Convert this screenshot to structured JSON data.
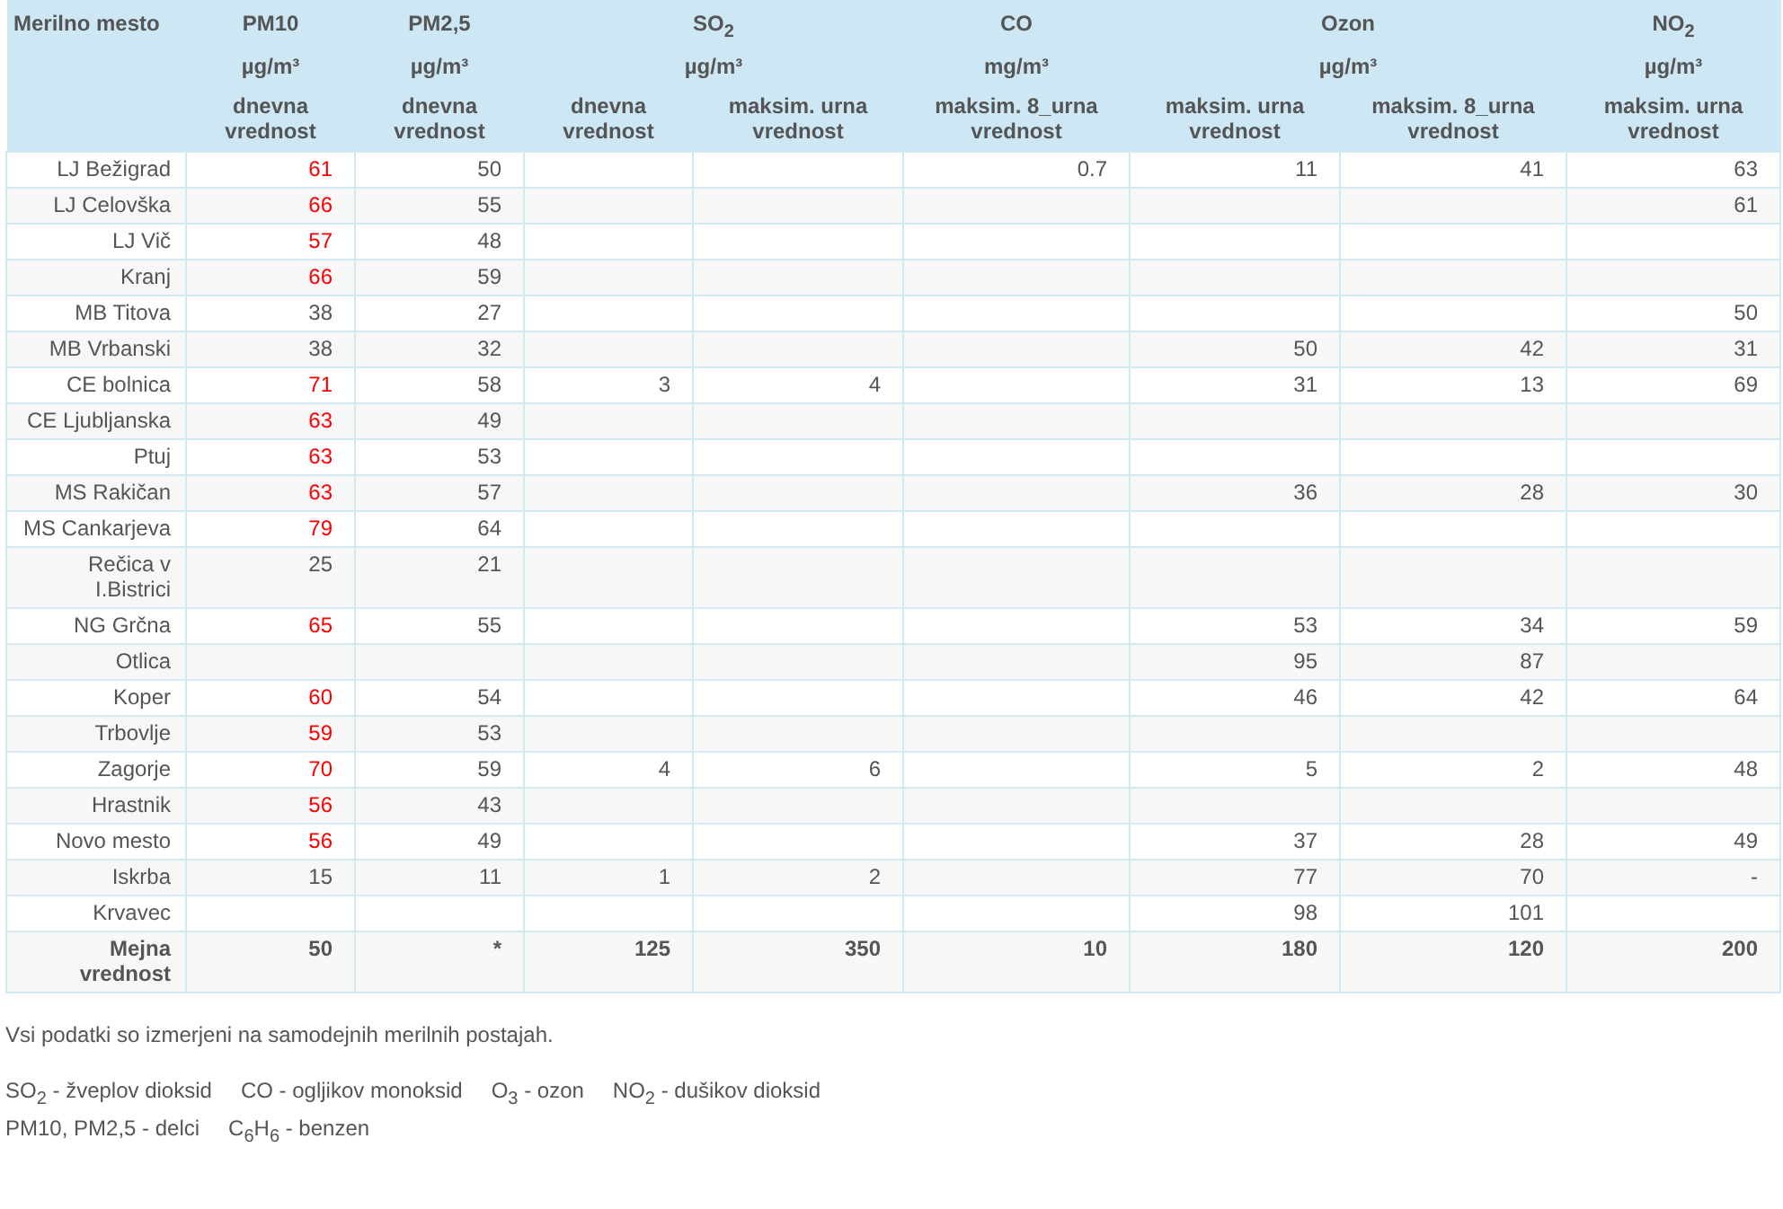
{
  "table": {
    "station_header": "Merilno mesto",
    "groups": [
      {
        "title": "PM10",
        "unit": "µg/m³",
        "columns": [
          "dnevna vrednost"
        ]
      },
      {
        "title": "PM2,5",
        "unit": "µg/m³",
        "columns": [
          "dnevna vrednost"
        ]
      },
      {
        "title": "SO$_{2}$",
        "unit": "µg/m³",
        "columns": [
          "dnevna vrednost",
          "maksim. urna vrednost"
        ]
      },
      {
        "title": "CO",
        "unit": "mg/m³",
        "columns": [
          "maksim. 8_urna vrednost"
        ]
      },
      {
        "title": "Ozon",
        "unit": "µg/m³",
        "columns": [
          "maksim. urna vrednost",
          "maksim. 8_urna vrednost"
        ]
      },
      {
        "title": "NO$_{2}$",
        "unit": "µg/m³",
        "columns": [
          "maksim. urna vrednost"
        ]
      }
    ],
    "rows": [
      {
        "kind": "station",
        "station": "LJ Bežigrad",
        "cells": [
          {
            "value": "61",
            "exceeded": true
          },
          {
            "value": "50"
          },
          null,
          null,
          {
            "value": "0.7"
          },
          {
            "value": "11"
          },
          {
            "value": "41"
          },
          {
            "value": "63"
          }
        ]
      },
      {
        "kind": "station",
        "station": "LJ Celovška",
        "cells": [
          {
            "value": "66",
            "exceeded": true
          },
          {
            "value": "55"
          },
          null,
          null,
          null,
          null,
          null,
          {
            "value": "61"
          }
        ]
      },
      {
        "kind": "station",
        "station": "LJ Vič",
        "cells": [
          {
            "value": "57",
            "exceeded": true
          },
          {
            "value": "48"
          },
          null,
          null,
          null,
          null,
          null,
          null
        ]
      },
      {
        "kind": "station",
        "station": "Kranj",
        "cells": [
          {
            "value": "66",
            "exceeded": true
          },
          {
            "value": "59"
          },
          null,
          null,
          null,
          null,
          null,
          null
        ]
      },
      {
        "kind": "station",
        "station": "MB Titova",
        "cells": [
          {
            "value": "38",
            "exceeded": false
          },
          {
            "value": "27"
          },
          null,
          null,
          null,
          null,
          null,
          {
            "value": "50"
          }
        ]
      },
      {
        "kind": "station",
        "station": "MB Vrbanski",
        "cells": [
          {
            "value": "38",
            "exceeded": false
          },
          {
            "value": "32"
          },
          null,
          null,
          null,
          {
            "value": "50"
          },
          {
            "value": "42"
          },
          {
            "value": "31"
          }
        ]
      },
      {
        "kind": "station",
        "station": "CE bolnica",
        "cells": [
          {
            "value": "71",
            "exceeded": true
          },
          {
            "value": "58"
          },
          {
            "value": "3"
          },
          {
            "value": "4"
          },
          null,
          {
            "value": "31"
          },
          {
            "value": "13"
          },
          {
            "value": "69"
          }
        ]
      },
      {
        "kind": "station",
        "station": "CE Ljubljanska",
        "cells": [
          {
            "value": "63",
            "exceeded": true
          },
          {
            "value": "49"
          },
          null,
          null,
          null,
          null,
          null,
          null
        ]
      },
      {
        "kind": "station",
        "station": "Ptuj",
        "cells": [
          {
            "value": "63",
            "exceeded": true
          },
          {
            "value": "53"
          },
          null,
          null,
          null,
          null,
          null,
          null
        ]
      },
      {
        "kind": "station",
        "station": "MS Rakičan",
        "cells": [
          {
            "value": "63",
            "exceeded": true
          },
          {
            "value": "57"
          },
          null,
          null,
          null,
          {
            "value": "36"
          },
          {
            "value": "28"
          },
          {
            "value": "30"
          }
        ]
      },
      {
        "kind": "station",
        "station": "MS Cankarjeva",
        "cells": [
          {
            "value": "79",
            "exceeded": true
          },
          {
            "value": "64"
          },
          null,
          null,
          null,
          null,
          null,
          null
        ]
      },
      {
        "kind": "station",
        "station": "Rečica v I.Bistrici",
        "cells": [
          {
            "value": "25",
            "exceeded": false
          },
          {
            "value": "21"
          },
          null,
          null,
          null,
          null,
          null,
          null
        ]
      },
      {
        "kind": "station",
        "station": "NG Grčna",
        "cells": [
          {
            "value": "65",
            "exceeded": true
          },
          {
            "value": "55"
          },
          null,
          null,
          null,
          {
            "value": "53"
          },
          {
            "value": "34"
          },
          {
            "value": "59"
          }
        ]
      },
      {
        "kind": "station",
        "station": "Otlica",
        "cells": [
          null,
          null,
          null,
          null,
          null,
          {
            "value": "95"
          },
          {
            "value": "87"
          },
          null
        ]
      },
      {
        "kind": "station",
        "station": "Koper",
        "cells": [
          {
            "value": "60",
            "exceeded": true
          },
          {
            "value": "54"
          },
          null,
          null,
          null,
          {
            "value": "46"
          },
          {
            "value": "42"
          },
          {
            "value": "64"
          }
        ]
      },
      {
        "kind": "station",
        "station": "Trbovlje",
        "cells": [
          {
            "value": "59",
            "exceeded": true
          },
          {
            "value": "53"
          },
          null,
          null,
          null,
          null,
          null,
          null
        ]
      },
      {
        "kind": "station",
        "station": "Zagorje",
        "cells": [
          {
            "value": "70",
            "exceeded": true
          },
          {
            "value": "59"
          },
          {
            "value": "4"
          },
          {
            "value": "6"
          },
          null,
          {
            "value": "5"
          },
          {
            "value": "2"
          },
          {
            "value": "48"
          }
        ]
      },
      {
        "kind": "station",
        "station": "Hrastnik",
        "cells": [
          {
            "value": "56",
            "exceeded": true
          },
          {
            "value": "43"
          },
          null,
          null,
          null,
          null,
          null,
          null
        ]
      },
      {
        "kind": "station",
        "station": "Novo mesto",
        "cells": [
          {
            "value": "56",
            "exceeded": true
          },
          {
            "value": "49"
          },
          null,
          null,
          null,
          {
            "value": "37"
          },
          {
            "value": "28"
          },
          {
            "value": "49"
          }
        ]
      },
      {
        "kind": "station",
        "station": "Iskrba",
        "cells": [
          {
            "value": "15",
            "exceeded": false
          },
          {
            "value": "11"
          },
          {
            "value": "1"
          },
          {
            "value": "2"
          },
          null,
          {
            "value": "77"
          },
          {
            "value": "70"
          },
          {
            "value": "-"
          }
        ]
      },
      {
        "kind": "station",
        "station": "Krvavec",
        "cells": [
          null,
          null,
          null,
          null,
          null,
          {
            "value": "98"
          },
          {
            "value": "101"
          },
          null
        ]
      },
      {
        "kind": "limit",
        "station": "Mejna vrednost",
        "cells": [
          {
            "value": "50"
          },
          {
            "value": "*"
          },
          {
            "value": "125"
          },
          {
            "value": "350"
          },
          {
            "value": "10"
          },
          {
            "value": "180"
          },
          {
            "value": "120"
          },
          {
            "value": "200"
          }
        ]
      }
    ]
  },
  "note": "Vsi podatki so izmerjeni na samodejnih merilnih postajah.",
  "legend": [
    [
      "SO$_{2}$ - žveplov dioksid",
      "CO - ogljikov monoksid",
      "O$_{3}$ - ozon",
      "NO$_{2}$ - dušikov dioksid"
    ],
    [
      "PM10, PM2,5 - delci",
      "C$_{6}$H$_{6}$ - benzen"
    ]
  ]
}
